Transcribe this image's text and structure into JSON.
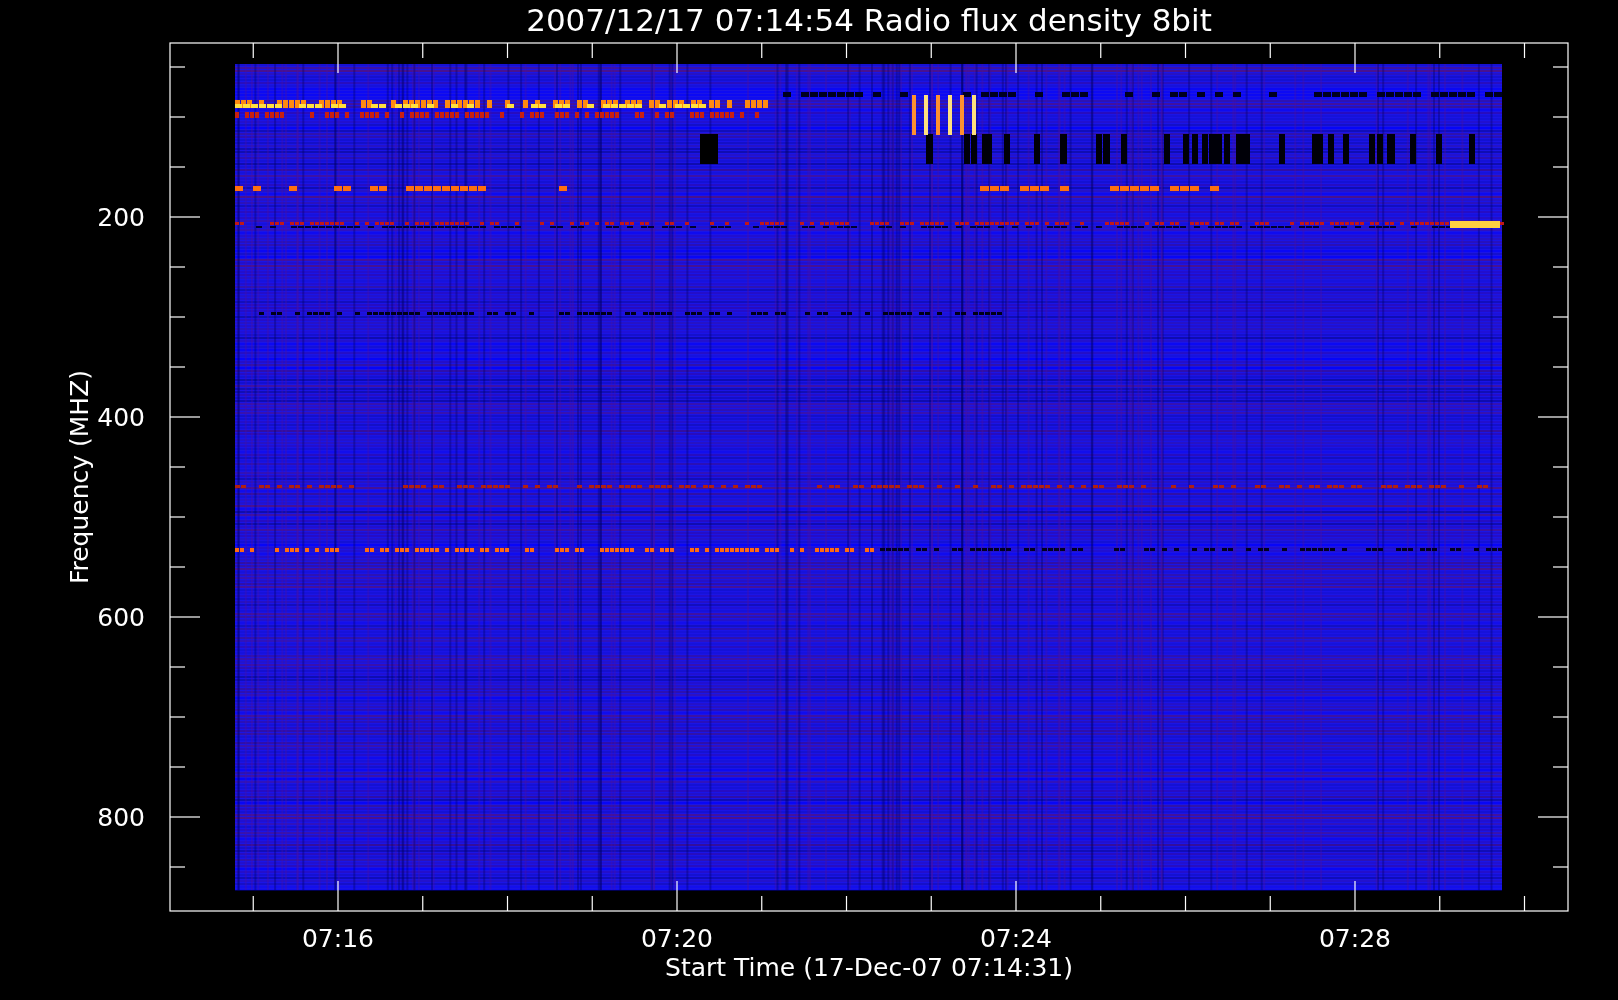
{
  "title": "2007/12/17 07:14:54 Radio flux density 8bit",
  "ylabel": "Frequency (MHZ)",
  "xlabel": "Start Time (17-Dec-07 07:14:31)",
  "yticks": [
    "200",
    "400",
    "600",
    "800"
  ],
  "xticks": [
    "07:16",
    "07:20",
    "07:24",
    "07:28"
  ]
}
